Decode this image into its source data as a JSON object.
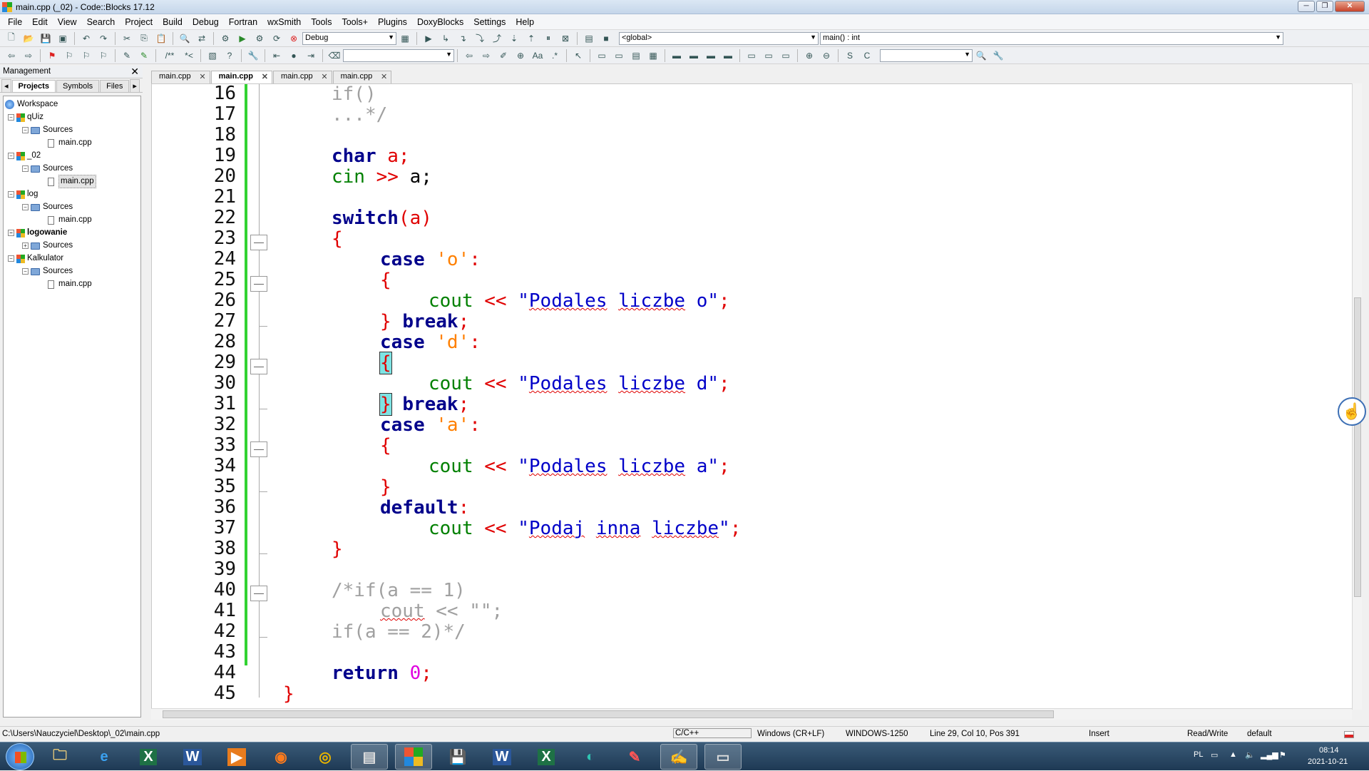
{
  "window": {
    "title": "main.cpp (_02) - Code::Blocks 17.12"
  },
  "menu": [
    "File",
    "Edit",
    "View",
    "Search",
    "Project",
    "Build",
    "Debug",
    "Fortran",
    "wxSmith",
    "Tools",
    "Tools+",
    "Plugins",
    "DoxyBlocks",
    "Settings",
    "Help"
  ],
  "toolbar": {
    "build_target": "Debug",
    "scope": "<global>",
    "function": "main() : int"
  },
  "management": {
    "title": "Management",
    "tabs": [
      "Projects",
      "Symbols",
      "Files"
    ],
    "tree": {
      "workspace": "Workspace",
      "projects": [
        {
          "name": "qUiz",
          "folder": "Sources",
          "file": "main.cpp"
        },
        {
          "name": "_02",
          "folder": "Sources",
          "file": "main.cpp"
        },
        {
          "name": "log",
          "folder": "Sources",
          "file": "main.cpp"
        },
        {
          "name": "logowanie",
          "folder": "Sources"
        },
        {
          "name": "Kalkulator",
          "folder": "Sources",
          "file": "main.cpp"
        }
      ]
    }
  },
  "editor_tabs": [
    "main.cpp",
    "main.cpp",
    "main.cpp",
    "main.cpp"
  ],
  "editor": {
    "line_numbers": [
      "16",
      "17",
      "18",
      "19",
      "20",
      "21",
      "22",
      "23",
      "24",
      "25",
      "26",
      "27",
      "28",
      "29",
      "30",
      "31",
      "32",
      "33",
      "34",
      "35",
      "36",
      "37",
      "38",
      "39",
      "40",
      "41",
      "42",
      "43",
      "44",
      "45"
    ],
    "code": {
      "l16": "if()",
      "l17": "...*/",
      "l19_kw": "char",
      "l19_rest": " a;",
      "l20_fn": "cin",
      "l20_op": " >> ",
      "l20_rest": "a;",
      "l22_kw": "switch",
      "l22_rest": "(a)",
      "open_brace": "{",
      "close_brace": "}",
      "case": "case",
      "break": "break",
      "cout": "cout",
      "shift": " << ",
      "default": "default",
      "return": "return",
      "zero": "0",
      "c_o": "'o'",
      "c_d": "'d'",
      "c_a": "'a'",
      "s_o_pre": "\"",
      "s_w1": "Podales",
      "s_w2": "liczbe",
      "s_o_end": " o\"",
      "s_d_end": " d\"",
      "s_a_end": " a\"",
      "s_def_w1": "Podaj",
      "s_def_w2": "inna",
      "s_def_w3": "liczbe",
      "s_def_end": "\"",
      "l40": "/*if(a == 1)",
      "l41_a": "cout",
      "l41_b": " << \"\";",
      "l42": "if(a == 2)*/"
    }
  },
  "status": {
    "path": "C:\\Users\\Nauczyciel\\Desktop\\_02\\main.cpp",
    "language": "C/C++",
    "eol": "Windows (CR+LF)",
    "encoding": "WINDOWS-1250",
    "position": "Line 29, Col 10, Pos 391",
    "mode": "Insert",
    "access": "Read/Write",
    "profile": "default"
  },
  "taskbar": {
    "apps": [
      "explorer",
      "ie",
      "excel-x",
      "word-w",
      "media",
      "firefox",
      "chrome",
      "files",
      "codeblocks",
      "save",
      "word",
      "excel",
      "edge",
      "paint",
      "notepad",
      "window"
    ],
    "lang": "PL",
    "time": "08:14",
    "date": "2021-10-21"
  }
}
